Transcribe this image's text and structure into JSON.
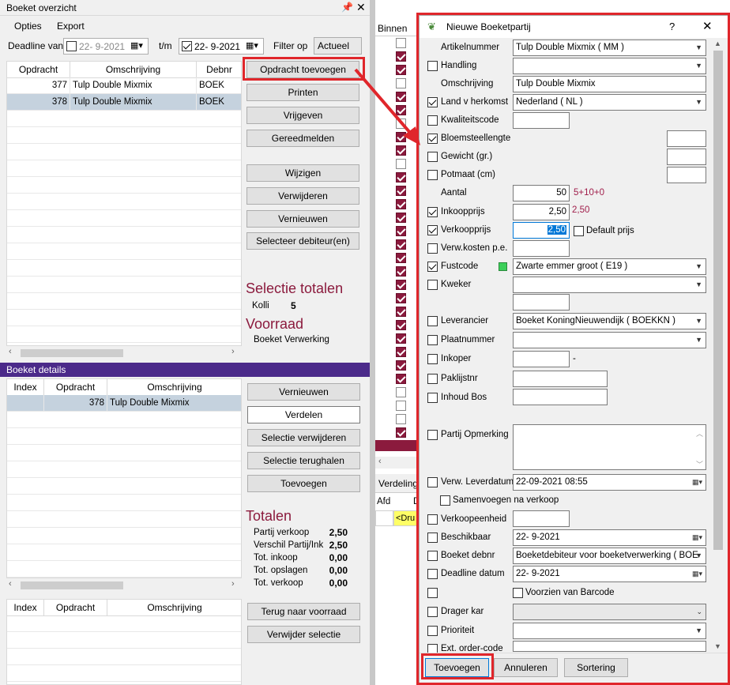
{
  "left": {
    "title": "Boeket overzicht",
    "menu": [
      "Opties",
      "Export"
    ],
    "filter": {
      "deadline_label": "Deadline van",
      "from_date": "22-  9-2021",
      "to_label": "t/m",
      "to_date": "22-  9-2021",
      "filter_label": "Filter op",
      "filter_value": "Actueel"
    },
    "top_table": {
      "headers": [
        "Opdracht",
        "Omschrijving",
        "Debnr"
      ],
      "rows": [
        [
          "377",
          "Tulp Double Mixmix",
          "BOEK"
        ],
        [
          "378",
          "Tulp Double Mixmix",
          "BOEK"
        ]
      ]
    },
    "top_buttons": [
      "Opdracht toevoegen",
      "Printen",
      "Vrijgeven",
      "Gereedmelden",
      "Wijzigen",
      "Verwijderen",
      "Vernieuwen",
      "Selecteer debiteur(en)"
    ],
    "selectie_totalen": "Selectie totalen",
    "kolli_label": "Kolli",
    "kolli_value": "5",
    "voorraad": "Voorraad",
    "voorraad_sub": "Boeket Verwerking",
    "details_title": "Boeket details",
    "details_table": {
      "headers": [
        "Index",
        "Opdracht",
        "Omschrijving"
      ],
      "rows": [
        [
          "",
          "378",
          "Tulp Double Mixmix"
        ]
      ]
    },
    "detail_buttons": [
      "Vernieuwen",
      "Verdelen",
      "Selectie verwijderen",
      "Selectie terughalen",
      "Toevoegen"
    ],
    "totalen": "Totalen",
    "totals": [
      {
        "label": "Partij verkoop",
        "value": "2,50"
      },
      {
        "label": "Verschil Partij/Ink",
        "value": "2,50"
      },
      {
        "label": "Tot. inkoop",
        "value": "0,00"
      },
      {
        "label": "Tot. opslagen",
        "value": "0,00"
      },
      {
        "label": "Tot. verkoop",
        "value": "0,00"
      }
    ],
    "bottom_table": {
      "headers": [
        "Index",
        "Opdracht",
        "Omschrijving"
      ]
    },
    "bottom_buttons": [
      "Terug naar voorraad",
      "Verwijder selectie"
    ]
  },
  "mid": {
    "header": "Binnen",
    "verdeling": "Verdeling",
    "afd": "Afd",
    "d": "D",
    "dru": "<Dru"
  },
  "dialog": {
    "title": "Nieuwe Boeketpartij",
    "help": "?",
    "close": "✕",
    "fields": {
      "artikelnummer": {
        "label": "Artikelnummer",
        "value": "Tulp Double Mixmix  ( MM )"
      },
      "handling": {
        "label": "Handling",
        "value": ""
      },
      "omschrijving": {
        "label": "Omschrijving",
        "value": "Tulp Double Mixmix"
      },
      "land": {
        "label": "Land v herkomst",
        "value": "Nederland  ( NL )"
      },
      "kwaliteitscode": {
        "label": "Kwaliteitscode",
        "value": ""
      },
      "bloemsteellengte": {
        "label": "Bloemsteellengte",
        "value": ""
      },
      "gewicht": {
        "label": "Gewicht (gr.)",
        "value": ""
      },
      "potmaat": {
        "label": "Potmaat (cm)",
        "value": ""
      },
      "aantal": {
        "label": "Aantal",
        "value": "50",
        "hint": "5+10+0"
      },
      "inkoopprijs": {
        "label": "Inkoopprijs",
        "value": "2,50",
        "hint": "2,50"
      },
      "verkoopprijs": {
        "label": "Verkoopprijs",
        "value": "2,50",
        "default_label": "Default prijs"
      },
      "verw_kosten": {
        "label": "Verw.kosten p.e.",
        "value": ""
      },
      "fustcode": {
        "label": "Fustcode",
        "value": "Zwarte emmer groot  ( E19 )"
      },
      "kweker": {
        "label": "Kweker",
        "value": ""
      },
      "leverancier": {
        "label": "Leverancier",
        "value": "Boeket KoningNieuwendijk  ( BOEKKN )"
      },
      "plaatnummer": {
        "label": "Plaatnummer",
        "value": ""
      },
      "inkoper": {
        "label": "Inkoper",
        "value": "",
        "dash": "-"
      },
      "paklijstnr": {
        "label": "Paklijstnr",
        "value": ""
      },
      "inhoud_bos": {
        "label": "Inhoud Bos",
        "value": ""
      },
      "partij_opmerking": {
        "label": "Partij Opmerking",
        "value": ""
      },
      "verw_leverdatum": {
        "label": "Verw. Leverdatum",
        "value": "22-09-2021 08:55"
      },
      "samenvoegen": {
        "label": "Samenvoegen na verkoop"
      },
      "verkoopeenheid": {
        "label": "Verkoopeenheid",
        "value": ""
      },
      "beschikbaar": {
        "label": "Beschikbaar",
        "value": "22-  9-2021"
      },
      "boeket_debnr": {
        "label": "Boeket debnr",
        "value": "Boeketdebiteur voor boeketverwerking  ( BOE"
      },
      "deadline_datum": {
        "label": "Deadline datum",
        "value": "22-  9-2021"
      },
      "barcode": {
        "label": "Voorzien van Barcode"
      },
      "drager_kar": {
        "label": "Drager kar",
        "value": ""
      },
      "prioriteit": {
        "label": "Prioriteit",
        "value": ""
      },
      "ext_order": {
        "label": "Ext. order-code",
        "value": ""
      }
    },
    "buttons": {
      "add": "Toevoegen",
      "cancel": "Annuleren",
      "sort": "Sortering"
    }
  },
  "colors": {
    "accent": "#8b1a3d",
    "highlight": "#e0262b",
    "panel_header": "#4b2a8a",
    "fust_green": "#3ccf5a"
  }
}
